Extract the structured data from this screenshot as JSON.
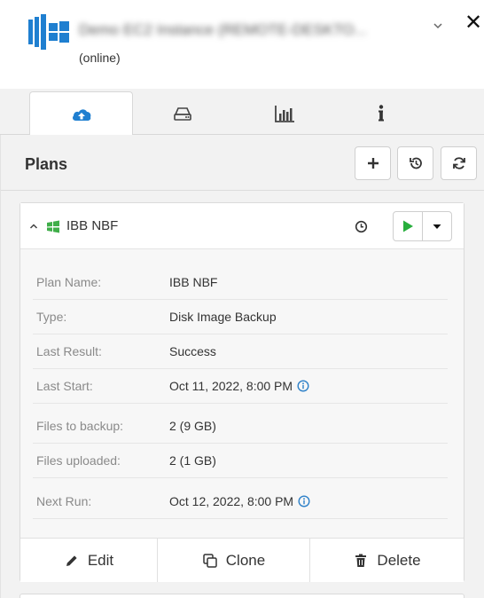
{
  "header": {
    "instance_name": "Demo EC2 Instance (REMOTE-DESKTO...",
    "status": "(online)"
  },
  "tabs": [
    {
      "name": "tab-plans",
      "icon": "cloud-upload-icon",
      "active": true
    },
    {
      "name": "tab-storage",
      "icon": "hard-drive-icon",
      "active": false
    },
    {
      "name": "tab-statistics",
      "icon": "bar-chart-icon",
      "active": false
    },
    {
      "name": "tab-info",
      "icon": "info-icon",
      "active": false
    }
  ],
  "plans": {
    "title": "Plans",
    "toolbar": [
      {
        "name": "add-plan-button",
        "icon": "plus-icon"
      },
      {
        "name": "history-button",
        "icon": "history-icon"
      },
      {
        "name": "refresh-button",
        "icon": "refresh-icon"
      }
    ]
  },
  "plan": {
    "title": "IBB NBF",
    "details": [
      {
        "label": "Plan Name:",
        "value": "IBB NBF",
        "info": false
      },
      {
        "label": "Type:",
        "value": "Disk Image Backup",
        "info": false
      },
      {
        "label": "Last Result:",
        "value": "Success",
        "info": false
      },
      {
        "label": "Last Start:",
        "value": "Oct 11, 2022, 8:00 PM",
        "info": true
      },
      {
        "label": "Files to backup:",
        "value": "2 (9 GB)",
        "info": false
      },
      {
        "label": "Files uploaded:",
        "value": "2 (1 GB)",
        "info": false
      },
      {
        "label": "Next Run:",
        "value": "Oct 12, 2022, 8:00 PM",
        "info": true
      }
    ],
    "actions": {
      "edit": "Edit",
      "clone": "Clone",
      "delete": "Delete"
    }
  },
  "colors": {
    "brand_blue": "#1f7fd0",
    "run_green": "#27ae3c",
    "windows_green": "#3fae49",
    "info_blue": "#2d80c8"
  }
}
